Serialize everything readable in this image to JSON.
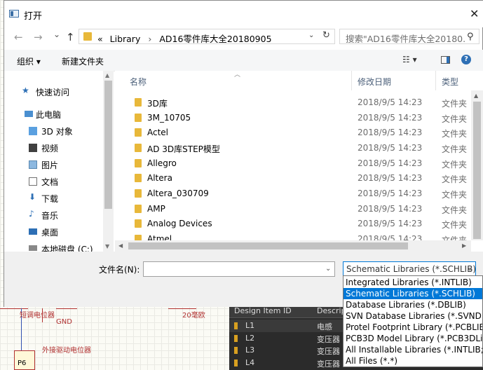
{
  "background_app": {
    "schematic": {
      "label_1": "短调电位器",
      "label_2": "GND",
      "label_3": "20毫欧",
      "label_4": "外接驱动电位器",
      "label_5": "P6"
    },
    "component_panel": {
      "columns": [
        "Design Item ID",
        "Descrip"
      ],
      "rows": [
        {
          "id": "L1",
          "desc": "电感"
        },
        {
          "id": "L2",
          "desc": "变压器"
        },
        {
          "id": "L3",
          "desc": "变压器"
        },
        {
          "id": "L4",
          "desc": "变压器"
        }
      ]
    }
  },
  "dialog": {
    "title": "打开",
    "close_glyph": "✕",
    "nav": {
      "back_glyph": "←",
      "forward_glyph": "→",
      "recent_glyph": "⌄",
      "up_glyph": "↑",
      "address": {
        "prefix": "«",
        "segments": [
          "Library",
          "AD16零件库大全20180905"
        ],
        "separator": "›"
      },
      "search_placeholder": "搜索\"AD16零件库大全20180...",
      "search_icon": "search-icon"
    },
    "toolbar": {
      "organize": "组织 ▾",
      "new_folder": "新建文件夹",
      "view_glyph": "☷ ▾"
    },
    "nav_pane": {
      "items": [
        {
          "label": "快速访问",
          "icon": "star-icon",
          "level": 0
        },
        {
          "label": "此电脑",
          "icon": "computer-icon",
          "level": 0
        },
        {
          "label": "3D 对象",
          "icon": "cube-icon",
          "level": 1
        },
        {
          "label": "视频",
          "icon": "video-icon",
          "level": 1
        },
        {
          "label": "图片",
          "icon": "picture-icon",
          "level": 1
        },
        {
          "label": "文档",
          "icon": "document-icon",
          "level": 1
        },
        {
          "label": "下载",
          "icon": "download-icon",
          "level": 1
        },
        {
          "label": "音乐",
          "icon": "music-icon",
          "level": 1
        },
        {
          "label": "桌面",
          "icon": "desktop-icon",
          "level": 1
        },
        {
          "label": "本地磁盘 (C:)",
          "icon": "drive-icon",
          "level": 1
        }
      ]
    },
    "file_list": {
      "columns": {
        "name": "名称",
        "date": "修改日期",
        "type": "类型"
      },
      "rows": [
        {
          "name": "3D库",
          "date": "2018/9/5 14:23",
          "type": "文件夹"
        },
        {
          "name": "3M_10705",
          "date": "2018/9/5 14:23",
          "type": "文件夹"
        },
        {
          "name": "Actel",
          "date": "2018/9/5 14:23",
          "type": "文件夹"
        },
        {
          "name": "AD 3D库STEP模型",
          "date": "2018/9/5 14:23",
          "type": "文件夹"
        },
        {
          "name": "Allegro",
          "date": "2018/9/5 14:23",
          "type": "文件夹"
        },
        {
          "name": "Altera",
          "date": "2018/9/5 14:23",
          "type": "文件夹"
        },
        {
          "name": "Altera_030709",
          "date": "2018/9/5 14:23",
          "type": "文件夹"
        },
        {
          "name": "AMP",
          "date": "2018/9/5 14:23",
          "type": "文件夹"
        },
        {
          "name": "Analog Devices",
          "date": "2018/9/5 14:23",
          "type": "文件夹"
        },
        {
          "name": "Atmel",
          "date": "2018/9/5 14:23",
          "type": "文件夹"
        }
      ]
    },
    "bottom": {
      "filename_label": "文件名(N):",
      "filename_value": "",
      "filetype_selected": "Schematic Libraries (*.SCHLIB)"
    },
    "filetype_options": [
      "Integrated Libraries (*.INTLIB)",
      "Schematic Libraries (*.SCHLIB)",
      "Database Libraries (*.DBLIB)",
      "SVN Database Libraries (*.SVNDB",
      "Protel Footprint Library (*.PCBLIE",
      "PCB3D Model Library (*.PCB3DLib",
      "All Installable Libraries (*.INTLIB;*",
      "All Files (*.*)"
    ],
    "filetype_selected_index": 1
  },
  "colors": {
    "accent": "#0078d7",
    "folder": "#e8b83a",
    "column_header_text": "#4c607a"
  }
}
